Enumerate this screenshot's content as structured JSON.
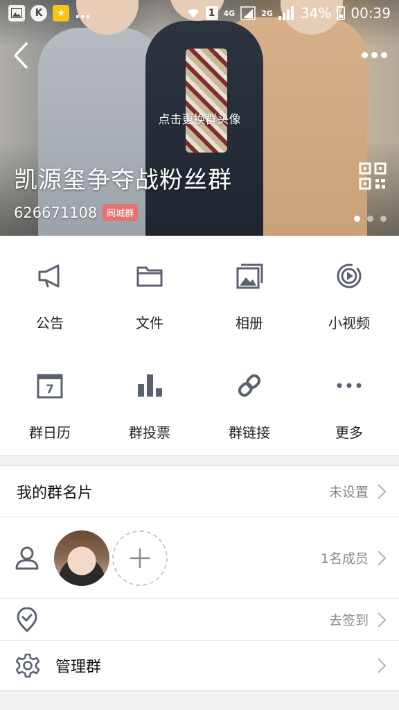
{
  "status_bar": {
    "left_more": "...",
    "badge_k": "K",
    "net_4g": "4G",
    "net_2g": "2G",
    "sim_slot": "1",
    "battery": "34%",
    "time": "00:39"
  },
  "header": {
    "change_avatar_hint": "点击更换群头像",
    "group_name": "凯源玺争夺战粉丝群",
    "group_id": "626671108",
    "city_badge": "同城群"
  },
  "features": [
    {
      "label": "公告",
      "icon": "megaphone-icon"
    },
    {
      "label": "文件",
      "icon": "folder-icon"
    },
    {
      "label": "相册",
      "icon": "album-icon"
    },
    {
      "label": "小视频",
      "icon": "video-icon"
    },
    {
      "label": "群日历",
      "icon": "calendar-icon",
      "calendar_day": "7"
    },
    {
      "label": "群投票",
      "icon": "bar-chart-icon"
    },
    {
      "label": "群链接",
      "icon": "link-icon"
    },
    {
      "label": "更多",
      "icon": "more-dots-icon"
    }
  ],
  "card": {
    "title": "我的群名片",
    "value": "未设置"
  },
  "members": {
    "count_text": "1名成员"
  },
  "signin": {
    "value": "去签到"
  },
  "manage": {
    "title": "管理群"
  },
  "colors": {
    "icon_gray": "#5b6170",
    "text_gray": "#888888",
    "badge": "#ec6e6e",
    "separator": "#f0f0f2"
  }
}
